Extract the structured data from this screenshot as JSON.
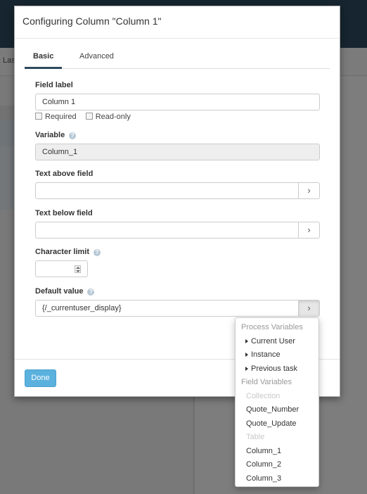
{
  "background": {
    "subheader_text": "Las"
  },
  "modal": {
    "title": "Configuring Column \"Column 1\"",
    "tabs": [
      {
        "label": "Basic",
        "active": true
      },
      {
        "label": "Advanced",
        "active": false
      }
    ],
    "field_label": {
      "label": "Field label",
      "value": "Column 1",
      "required_label": "Required",
      "readonly_label": "Read-only"
    },
    "variable": {
      "label": "Variable",
      "value": "Column_1"
    },
    "text_above": {
      "label": "Text above field",
      "value": ""
    },
    "text_below": {
      "label": "Text below field",
      "value": ""
    },
    "char_limit": {
      "label": "Character limit",
      "value": ""
    },
    "default_value": {
      "label": "Default value",
      "value": "{/_currentuser_display}"
    },
    "addon_icon": "›",
    "done_label": "Done"
  },
  "dropdown": {
    "process_variables_header": "Process Variables",
    "process_items": [
      "Current User",
      "Instance",
      "Previous task"
    ],
    "field_variables_header": "Field Variables",
    "collection_header": "Collection",
    "collection_items": [
      "Quote_Number",
      "Quote_Update"
    ],
    "table_header": "Table",
    "table_items": [
      "Column_1",
      "Column_2",
      "Column_3"
    ]
  },
  "colors": {
    "primary_button": "#5bb1de",
    "active_tab_underline": "#2d4a5e",
    "app_header": "#2d4a5e",
    "help_icon": "#b8c9d6"
  }
}
